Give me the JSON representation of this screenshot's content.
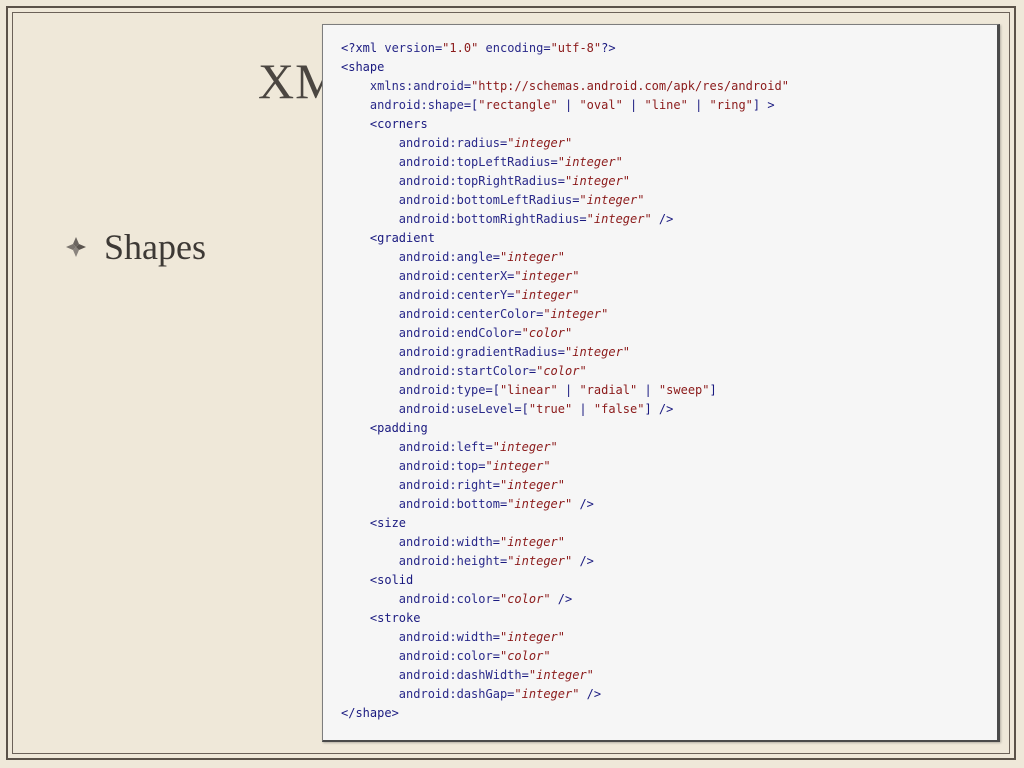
{
  "slide": {
    "title": "XML",
    "bullet": "Shapes",
    "bullet_icon": "diamond-bullet-icon"
  },
  "code_lines": [
    [
      [
        "tag",
        "<?xml "
      ],
      [
        "attr",
        "version"
      ],
      [
        "tag",
        "="
      ],
      [
        "str",
        "\"1.0\""
      ],
      [
        "tag",
        " "
      ],
      [
        "attr",
        "encoding"
      ],
      [
        "tag",
        "="
      ],
      [
        "str",
        "\"utf-8\""
      ],
      [
        "tag",
        "?>"
      ]
    ],
    [
      [
        "tag",
        "<shape"
      ]
    ],
    [
      [
        "tag",
        "    "
      ],
      [
        "attr",
        "xmlns:android"
      ],
      [
        "tag",
        "="
      ],
      [
        "str",
        "\"http://schemas.android.com/apk/res/android\""
      ]
    ],
    [
      [
        "tag",
        "    "
      ],
      [
        "attr",
        "android:shape"
      ],
      [
        "tag",
        "=["
      ],
      [
        "str",
        "\"rectangle\""
      ],
      [
        "tag",
        " | "
      ],
      [
        "str",
        "\"oval\""
      ],
      [
        "tag",
        " | "
      ],
      [
        "str",
        "\"line\""
      ],
      [
        "tag",
        " | "
      ],
      [
        "str",
        "\"ring\""
      ],
      [
        "tag",
        "] >"
      ]
    ],
    [
      [
        "tag",
        "    <corners"
      ]
    ],
    [
      [
        "tag",
        "        "
      ],
      [
        "attr",
        "android:radius"
      ],
      [
        "tag",
        "="
      ],
      [
        "str",
        "\""
      ],
      [
        "ital",
        "integer"
      ],
      [
        "str",
        "\""
      ]
    ],
    [
      [
        "tag",
        "        "
      ],
      [
        "attr",
        "android:topLeftRadius"
      ],
      [
        "tag",
        "="
      ],
      [
        "str",
        "\""
      ],
      [
        "ital",
        "integer"
      ],
      [
        "str",
        "\""
      ]
    ],
    [
      [
        "tag",
        "        "
      ],
      [
        "attr",
        "android:topRightRadius"
      ],
      [
        "tag",
        "="
      ],
      [
        "str",
        "\""
      ],
      [
        "ital",
        "integer"
      ],
      [
        "str",
        "\""
      ]
    ],
    [
      [
        "tag",
        "        "
      ],
      [
        "attr",
        "android:bottomLeftRadius"
      ],
      [
        "tag",
        "="
      ],
      [
        "str",
        "\""
      ],
      [
        "ital",
        "integer"
      ],
      [
        "str",
        "\""
      ]
    ],
    [
      [
        "tag",
        "        "
      ],
      [
        "attr",
        "android:bottomRightRadius"
      ],
      [
        "tag",
        "="
      ],
      [
        "str",
        "\""
      ],
      [
        "ital",
        "integer"
      ],
      [
        "str",
        "\""
      ],
      [
        "tag",
        " />"
      ]
    ],
    [
      [
        "tag",
        "    <gradient"
      ]
    ],
    [
      [
        "tag",
        "        "
      ],
      [
        "attr",
        "android:angle"
      ],
      [
        "tag",
        "="
      ],
      [
        "str",
        "\""
      ],
      [
        "ital",
        "integer"
      ],
      [
        "str",
        "\""
      ]
    ],
    [
      [
        "tag",
        "        "
      ],
      [
        "attr",
        "android:centerX"
      ],
      [
        "tag",
        "="
      ],
      [
        "str",
        "\""
      ],
      [
        "ital",
        "integer"
      ],
      [
        "str",
        "\""
      ]
    ],
    [
      [
        "tag",
        "        "
      ],
      [
        "attr",
        "android:centerY"
      ],
      [
        "tag",
        "="
      ],
      [
        "str",
        "\""
      ],
      [
        "ital",
        "integer"
      ],
      [
        "str",
        "\""
      ]
    ],
    [
      [
        "tag",
        "        "
      ],
      [
        "attr",
        "android:centerColor"
      ],
      [
        "tag",
        "="
      ],
      [
        "str",
        "\""
      ],
      [
        "ital",
        "integer"
      ],
      [
        "str",
        "\""
      ]
    ],
    [
      [
        "tag",
        "        "
      ],
      [
        "attr",
        "android:endColor"
      ],
      [
        "tag",
        "="
      ],
      [
        "str",
        "\""
      ],
      [
        "ital",
        "color"
      ],
      [
        "str",
        "\""
      ]
    ],
    [
      [
        "tag",
        "        "
      ],
      [
        "attr",
        "android:gradientRadius"
      ],
      [
        "tag",
        "="
      ],
      [
        "str",
        "\""
      ],
      [
        "ital",
        "integer"
      ],
      [
        "str",
        "\""
      ]
    ],
    [
      [
        "tag",
        "        "
      ],
      [
        "attr",
        "android:startColor"
      ],
      [
        "tag",
        "="
      ],
      [
        "str",
        "\""
      ],
      [
        "ital",
        "color"
      ],
      [
        "str",
        "\""
      ]
    ],
    [
      [
        "tag",
        "        "
      ],
      [
        "attr",
        "android:type"
      ],
      [
        "tag",
        "=["
      ],
      [
        "str",
        "\"linear\""
      ],
      [
        "tag",
        " | "
      ],
      [
        "str",
        "\"radial\""
      ],
      [
        "tag",
        " | "
      ],
      [
        "str",
        "\"sweep\""
      ],
      [
        "tag",
        "]"
      ]
    ],
    [
      [
        "tag",
        "        "
      ],
      [
        "attr",
        "android:useLevel"
      ],
      [
        "tag",
        "=["
      ],
      [
        "str",
        "\"true\""
      ],
      [
        "tag",
        " | "
      ],
      [
        "str",
        "\"false\""
      ],
      [
        "tag",
        "] />"
      ]
    ],
    [
      [
        "tag",
        "    <padding"
      ]
    ],
    [
      [
        "tag",
        "        "
      ],
      [
        "attr",
        "android:left"
      ],
      [
        "tag",
        "="
      ],
      [
        "str",
        "\""
      ],
      [
        "ital",
        "integer"
      ],
      [
        "str",
        "\""
      ]
    ],
    [
      [
        "tag",
        "        "
      ],
      [
        "attr",
        "android:top"
      ],
      [
        "tag",
        "="
      ],
      [
        "str",
        "\""
      ],
      [
        "ital",
        "integer"
      ],
      [
        "str",
        "\""
      ]
    ],
    [
      [
        "tag",
        "        "
      ],
      [
        "attr",
        "android:right"
      ],
      [
        "tag",
        "="
      ],
      [
        "str",
        "\""
      ],
      [
        "ital",
        "integer"
      ],
      [
        "str",
        "\""
      ]
    ],
    [
      [
        "tag",
        "        "
      ],
      [
        "attr",
        "android:bottom"
      ],
      [
        "tag",
        "="
      ],
      [
        "str",
        "\""
      ],
      [
        "ital",
        "integer"
      ],
      [
        "str",
        "\""
      ],
      [
        "tag",
        " />"
      ]
    ],
    [
      [
        "tag",
        "    <size"
      ]
    ],
    [
      [
        "tag",
        "        "
      ],
      [
        "attr",
        "android:width"
      ],
      [
        "tag",
        "="
      ],
      [
        "str",
        "\""
      ],
      [
        "ital",
        "integer"
      ],
      [
        "str",
        "\""
      ]
    ],
    [
      [
        "tag",
        "        "
      ],
      [
        "attr",
        "android:height"
      ],
      [
        "tag",
        "="
      ],
      [
        "str",
        "\""
      ],
      [
        "ital",
        "integer"
      ],
      [
        "str",
        "\""
      ],
      [
        "tag",
        " />"
      ]
    ],
    [
      [
        "tag",
        "    <solid"
      ]
    ],
    [
      [
        "tag",
        "        "
      ],
      [
        "attr",
        "android:color"
      ],
      [
        "tag",
        "="
      ],
      [
        "str",
        "\""
      ],
      [
        "ital",
        "color"
      ],
      [
        "str",
        "\""
      ],
      [
        "tag",
        " />"
      ]
    ],
    [
      [
        "tag",
        "    <stroke"
      ]
    ],
    [
      [
        "tag",
        "        "
      ],
      [
        "attr",
        "android:width"
      ],
      [
        "tag",
        "="
      ],
      [
        "str",
        "\""
      ],
      [
        "ital",
        "integer"
      ],
      [
        "str",
        "\""
      ]
    ],
    [
      [
        "tag",
        "        "
      ],
      [
        "attr",
        "android:color"
      ],
      [
        "tag",
        "="
      ],
      [
        "str",
        "\""
      ],
      [
        "ital",
        "color"
      ],
      [
        "str",
        "\""
      ]
    ],
    [
      [
        "tag",
        "        "
      ],
      [
        "attr",
        "android:dashWidth"
      ],
      [
        "tag",
        "="
      ],
      [
        "str",
        "\""
      ],
      [
        "ital",
        "integer"
      ],
      [
        "str",
        "\""
      ]
    ],
    [
      [
        "tag",
        "        "
      ],
      [
        "attr",
        "android:dashGap"
      ],
      [
        "tag",
        "="
      ],
      [
        "str",
        "\""
      ],
      [
        "ital",
        "integer"
      ],
      [
        "str",
        "\""
      ],
      [
        "tag",
        " />"
      ]
    ],
    [
      [
        "tag",
        "</shape>"
      ]
    ]
  ]
}
